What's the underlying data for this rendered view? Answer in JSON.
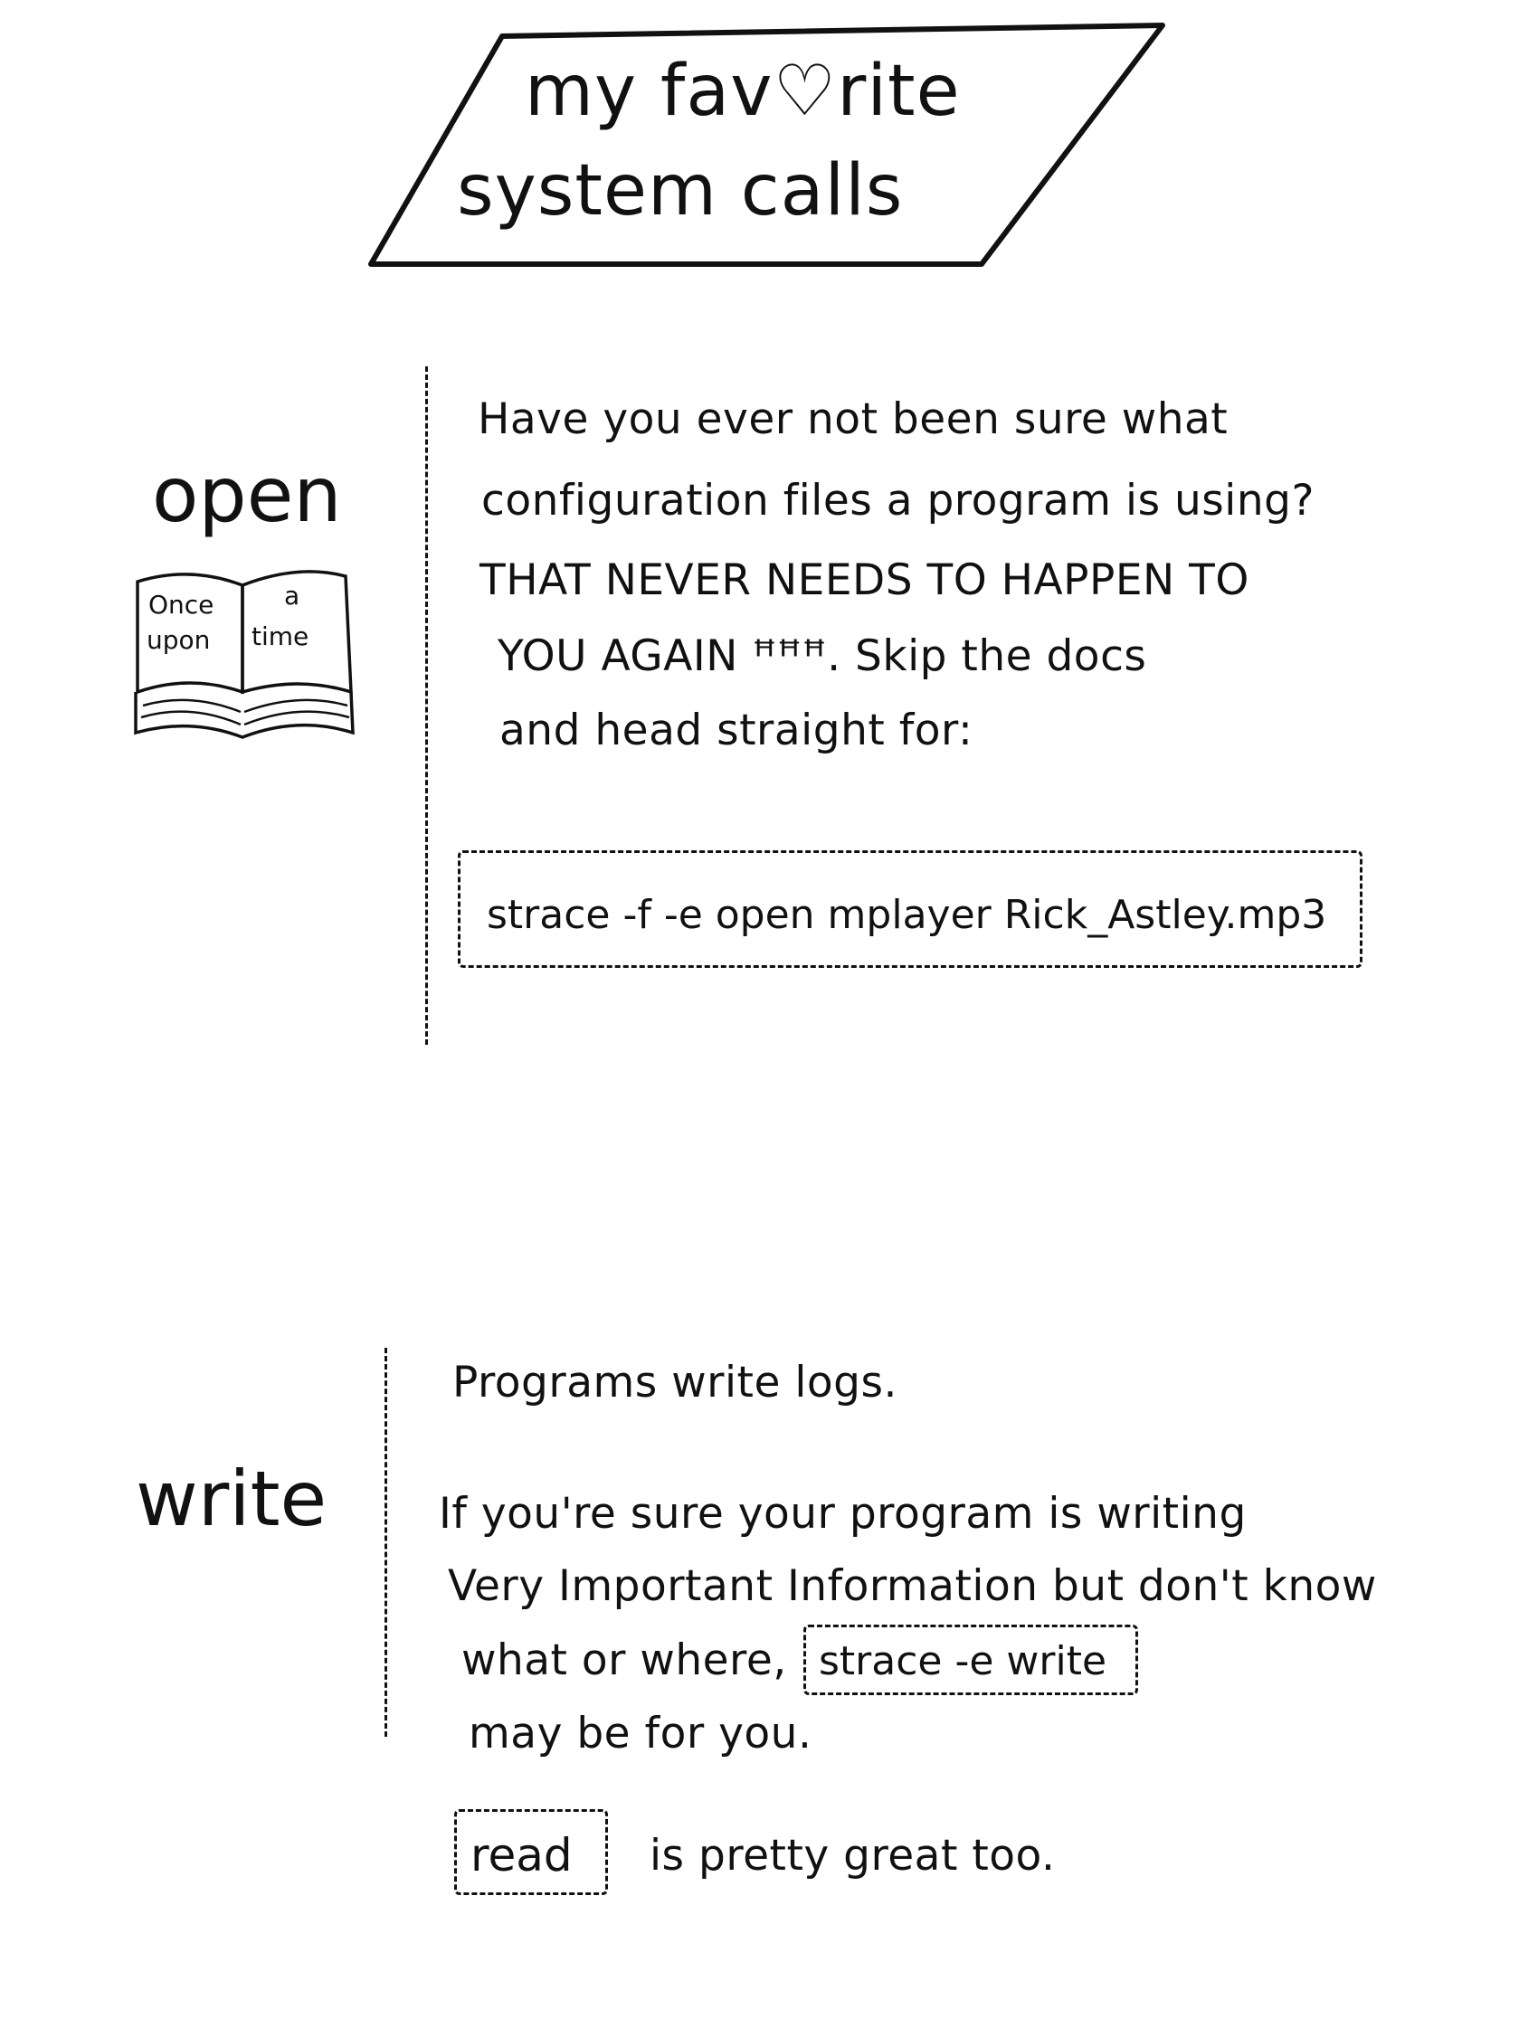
{
  "title": {
    "line1": "my fav♡rite",
    "line2": "system calls"
  },
  "open_section": {
    "label": "open",
    "book": {
      "left_page_line1": "Once",
      "left_page_line2": "upon",
      "right_page_line1": "a",
      "right_page_line2": "time"
    },
    "body_lines": [
      "Have you ever not been sure what",
      "configuration files a program is using?",
      "THAT NEVER NEEDS TO HAPPEN TO",
      "YOU AGAIN ꟸꟸꟸ. Skip the docs",
      "and head straight for:"
    ],
    "command": "strace -f -e open mplayer Rick_Astley.mp3"
  },
  "write_section": {
    "label": "write",
    "line1": "Programs write logs.",
    "line2": "If you're sure your program is writing",
    "line3": "Very Important Information but don't know",
    "line4_prefix": "what or where,",
    "inline_command": "strace -e write",
    "line5": "may be for you.",
    "read_command": "read",
    "read_suffix": "is pretty great too."
  }
}
